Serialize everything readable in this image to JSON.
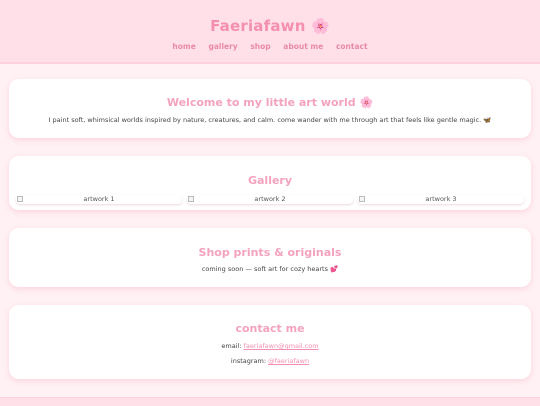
{
  "header": {
    "title": "Faeriafawn 🌸",
    "nav": [
      "home",
      "gallery",
      "shop",
      "about me",
      "contact"
    ]
  },
  "welcome": {
    "title": "Welcome to my little art world 🌸",
    "text": "I paint soft, whimsical worlds inspired by nature, creatures, and calm. come wander with me through art that feels like gentle magic. 🦋"
  },
  "gallery": {
    "title": "Gallery",
    "items": [
      "artwork 1",
      "artwork 2",
      "artwork 3"
    ]
  },
  "shop": {
    "title": "Shop prints & originals",
    "text": "coming soon — soft art for cozy hearts 💕"
  },
  "contact": {
    "title": "contact me",
    "email_label": "email:",
    "email": "faeriafawn@gmail.com",
    "instagram_label": "instagram:",
    "instagram": "@faeriafawn"
  },
  "colors": {
    "accent": "#f48fb1",
    "header_bg": "#ffe0e8",
    "page_bg": "#fff1f4"
  }
}
